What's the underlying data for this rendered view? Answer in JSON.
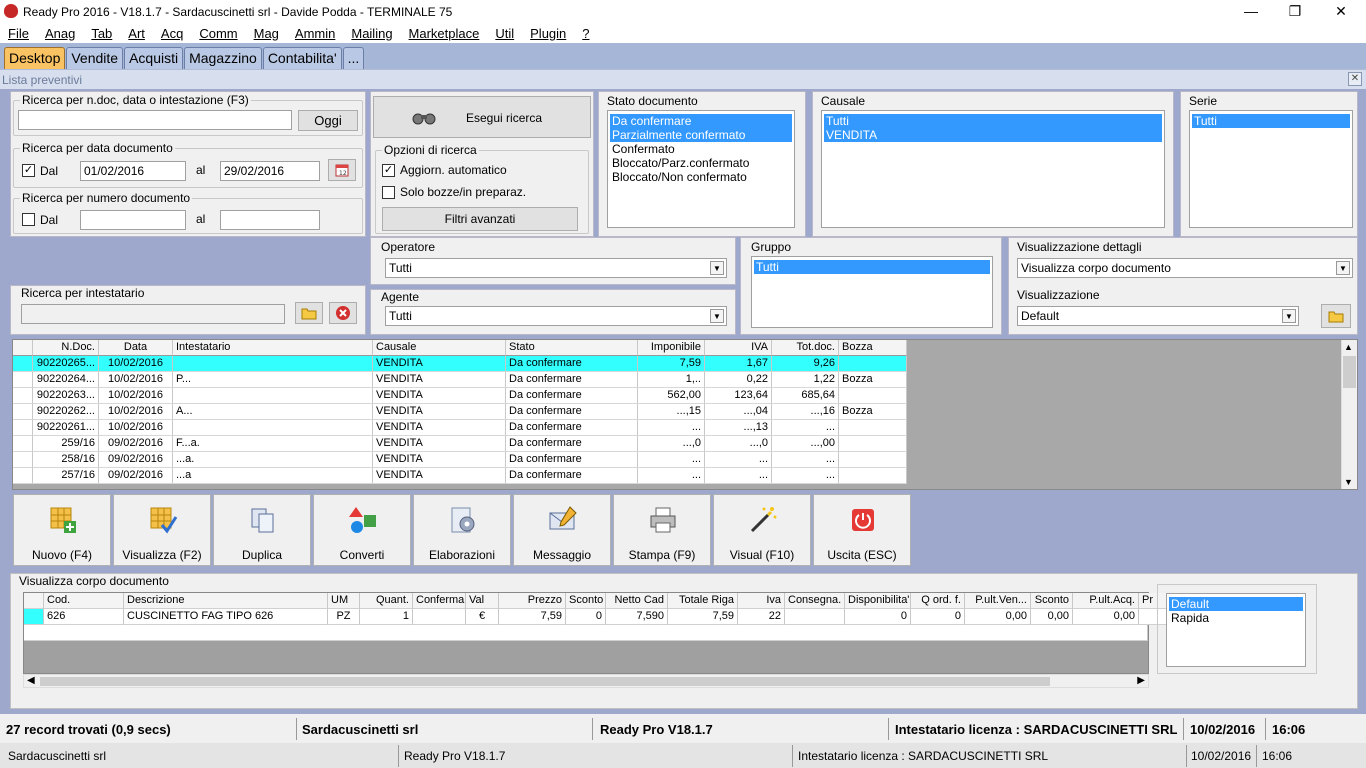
{
  "window": {
    "title": "Ready Pro 2016 - V18.1.7 - Sardacuscinetti srl - Davide Podda - TERMINALE 75",
    "min": "—",
    "max": "❐",
    "close": "✕"
  },
  "menu": [
    "File",
    "Anag",
    "Tab",
    "Art",
    "Acq",
    "Comm",
    "Mag",
    "Ammin",
    "Mailing",
    "Marketplace",
    "Util",
    "Plugin",
    "?"
  ],
  "tabs": [
    "Desktop",
    "Vendite",
    "Acquisti",
    "Magazzino",
    "Contabilita'",
    "..."
  ],
  "subbar": {
    "label": "Lista preventivi"
  },
  "search": {
    "ndoc_caption": "Ricerca per n.doc, data o intestazione (F3)",
    "ndoc_value": "",
    "oggi_label": "Oggi",
    "date_caption": "Ricerca per data documento",
    "date_dal_label": "Dal",
    "date_checked": "✓",
    "date_from": "01/02/2016",
    "date_al_label": "al",
    "date_to": "29/02/2016",
    "num_caption": "Ricerca per numero documento",
    "num_dal_label": "Dal",
    "num_al_label": "al",
    "num_from": "",
    "num_to": "",
    "intest_caption": "Ricerca per intestatario",
    "intest_value": ""
  },
  "actions": {
    "esegui_label": "Esegui ricerca"
  },
  "options": {
    "caption": "Opzioni di ricerca",
    "aggiorn_label": "Aggiorn. automatico",
    "aggiorn_checked": "✓",
    "bozze_label": "Solo bozze/in preparaz.",
    "filtri_label": "Filtri avanzati"
  },
  "stato": {
    "caption": "Stato documento",
    "items": [
      "Da confermare",
      "Parzialmente confermato",
      "Confermato",
      "Bloccato/Parz.confermato",
      "Bloccato/Non confermato"
    ]
  },
  "causale": {
    "caption": "Causale",
    "items": [
      "Tutti",
      "VENDITA"
    ]
  },
  "serie": {
    "caption": "Serie",
    "items": [
      "Tutti"
    ]
  },
  "operatore": {
    "caption": "Operatore",
    "value": "Tutti"
  },
  "agente": {
    "caption": "Agente",
    "value": "Tutti"
  },
  "gruppo": {
    "caption": "Gruppo",
    "items": [
      "Tutti"
    ]
  },
  "vis_dettagli": {
    "caption": "Visualizzazione dettagli",
    "value": "Visualizza corpo documento"
  },
  "visualizzazione": {
    "caption": "Visualizzazione",
    "value": "Default"
  },
  "grid": {
    "headers": [
      "N.Doc.",
      "Data",
      "Intestatario",
      "Causale",
      "Stato",
      "Imponibile",
      "IVA",
      "Tot.doc.",
      "Bozza"
    ],
    "rows": [
      [
        "90220265...",
        "10/02/2016",
        "",
        "VENDITA",
        "Da confermare",
        "7,59",
        "1,67",
        "9,26",
        ""
      ],
      [
        "90220264...",
        "10/02/2016",
        "P...",
        "VENDITA",
        "Da confermare",
        "1,..",
        "0,22",
        "1,22",
        "Bozza"
      ],
      [
        "90220263...",
        "10/02/2016",
        "",
        "VENDITA",
        "Da confermare",
        "562,00",
        "123,64",
        "685,64",
        ""
      ],
      [
        "90220262...",
        "10/02/2016",
        "A...",
        "VENDITA",
        "Da confermare",
        "...,15",
        "...,04",
        "...,16",
        "Bozza"
      ],
      [
        "90220261...",
        "10/02/2016",
        "",
        "VENDITA",
        "Da confermare",
        "...",
        "...,13",
        "...",
        ""
      ],
      [
        "259/16",
        "09/02/2016",
        "F...a.",
        "VENDITA",
        "Da confermare",
        "...,0",
        "...,0",
        "...,00",
        ""
      ],
      [
        "258/16",
        "09/02/2016",
        "...a.",
        "VENDITA",
        "Da confermare",
        "...",
        "...",
        "...",
        ""
      ],
      [
        "257/16",
        "09/02/2016",
        "...a",
        "VENDITA",
        "Da confermare",
        "...",
        "...",
        "...",
        ""
      ]
    ]
  },
  "toolbar": [
    "Nuovo (F4)",
    "Visualizza (F2)",
    "Duplica",
    "Converti",
    "Elaborazioni",
    "Messaggio",
    "Stampa (F9)",
    "Visual (F10)",
    "Uscita (ESC)"
  ],
  "detail": {
    "caption": "Visualizza corpo documento",
    "headers": [
      "Cod.",
      "Descrizione",
      "UM",
      "Quant.",
      "Conferma",
      "Val",
      "Prezzo",
      "Sconto",
      "Netto Cad",
      "Totale Riga",
      "Iva",
      "Consegna.",
      "Disponibilita'",
      "Q ord. f.",
      "P.ult.Ven...",
      "Sconto",
      "P.ult.Acq.",
      "Pr"
    ],
    "row": [
      "626",
      "CUSCINETTO FAG TIPO  626",
      "PZ",
      "1",
      "",
      "€",
      "7,59",
      "0",
      "7,590",
      "7,59",
      "22",
      "",
      "0",
      "0",
      "0,00",
      "0,00",
      "0,00",
      ""
    ],
    "layouts": [
      "Default",
      "Rapida"
    ]
  },
  "status1": {
    "records": "27 record trovati (0,9 secs)",
    "company": "Sardacuscinetti srl",
    "version": "Ready Pro V18.1.7",
    "license": "Intestatario licenza : SARDACUSCINETTI SRL",
    "date": "10/02/2016",
    "time": "16:06"
  },
  "status2": {
    "company": "Sardacuscinetti srl",
    "version": "Ready Pro V18.1.7",
    "license": "Intestatario licenza : SARDACUSCINETTI SRL",
    "date": "10/02/2016",
    "time": "16:06"
  },
  "colors": {
    "tab_active": "#f9c263",
    "selection": "#3399ff",
    "grid_selected_row": "#33ffff",
    "workspace": "#9ea8cc"
  }
}
